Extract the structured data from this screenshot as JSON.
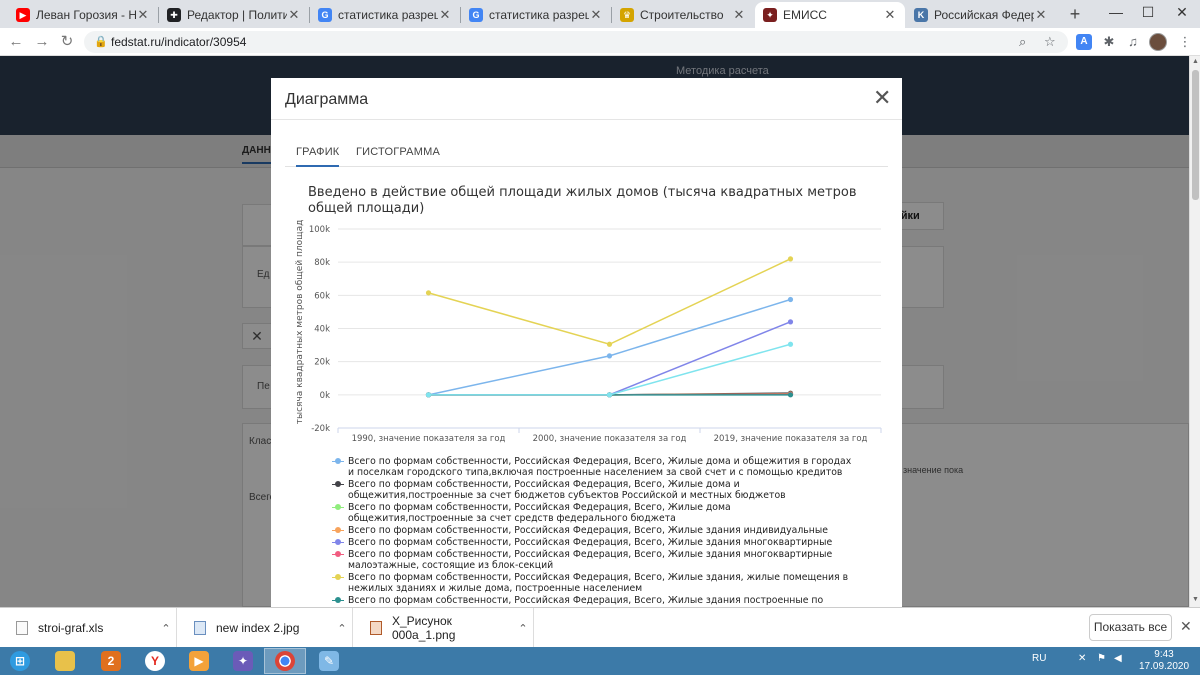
{
  "browser": {
    "tabs": [
      {
        "title": "Леван Горозия - Н",
        "icon": "youtube-icon",
        "color": "#ff0000",
        "glyph": "▶"
      },
      {
        "title": "Редактор | Политика П",
        "icon": "editor-icon",
        "color": "#202124",
        "glyph": "✚"
      },
      {
        "title": "статистика разрешени",
        "icon": "google-icon",
        "color": "#4285f4",
        "glyph": "G"
      },
      {
        "title": "статистика разрешени",
        "icon": "google-icon",
        "color": "#4285f4",
        "glyph": "G"
      },
      {
        "title": "Строительство",
        "icon": "emblem-icon",
        "color": "#d4a400",
        "glyph": "♛"
      },
      {
        "title": "ЕМИСС",
        "icon": "eagle-icon",
        "color": "#7a1f1f",
        "glyph": "✦"
      },
      {
        "title": "Российская Федерация",
        "icon": "k-icon",
        "color": "#4a76a8",
        "glyph": "K"
      }
    ],
    "url": "fedstat.ru/indicator/30954",
    "new_tab": "+",
    "win_min": "—",
    "win_max": "☐",
    "win_close": "✕"
  },
  "page_behind": {
    "method": "Методика расчета",
    "tab_data": "ДАННЫ",
    "settings_btn": "ойки",
    "ed": "Ед",
    "pe": "Пе",
    "klass": "Класс",
    "vsego": "Всего",
    "znach": "значение пока"
  },
  "modal": {
    "title": "Диаграмма",
    "close": "✕",
    "tabs": [
      "ГРАФИК",
      "ГИСТОГРАММА"
    ],
    "chart_title": "Введено в действие общей площади жилых домов (тысяча квадратных метров общей площади)"
  },
  "chart_data": {
    "type": "line",
    "title": "Введено в действие общей площади жилых домов (тысяча квадратных метров общей площади)",
    "ylabel": "тысяча квадратных метров общей площади",
    "xlabel": "",
    "categories": [
      "1990, значение показателя за год",
      "2000, значение показателя за год",
      "2019, значение показателя за год"
    ],
    "y_ticks": [
      "100k",
      "80k",
      "60k",
      "40k",
      "20k",
      "0k",
      "-20k"
    ],
    "ylim": [
      -20000,
      100000
    ],
    "grid": true,
    "legend_position": "bottom",
    "series": [
      {
        "name": "Всего по формам собственности, Российская Федерация, Всего, Жилые дома и общежития в городах и поселкам городского типа,включая построенные населением за свой счет и с помощью кредитов",
        "color": "#7cb5ec",
        "values": [
          0,
          23500,
          57500
        ]
      },
      {
        "name": "Всего по формам собственности, Российская Федерация, Всего, Жилые дома и общежития,построенные за счет бюджетов субъектов Российской и местных бюджетов",
        "color": "#434348",
        "values": [
          0,
          0,
          1000
        ]
      },
      {
        "name": "Всего по формам собственности, Российская Федерация, Всего, Жилые дома общежития,построенные за счет средств федерального бюджета",
        "color": "#90ed7d",
        "values": [
          0,
          0,
          300
        ]
      },
      {
        "name": "Всего по формам собственности, Российская Федерация, Всего, Жилые здания индивидуальные",
        "color": "#f7a35c",
        "values": [
          0,
          0,
          500
        ]
      },
      {
        "name": "Всего по формам собственности, Российская Федерация, Всего, Жилые здания многоквартирные",
        "color": "#8085e9",
        "values": [
          0,
          0,
          44000
        ]
      },
      {
        "name": "Всего по формам собственности, Российская Федерация, Всего, Жилые здания многоквартирные малоэтажные, состоящие из блок-секций",
        "color": "#f15c80",
        "values": [
          0,
          0,
          200
        ]
      },
      {
        "name": "Всего по формам собственности, Российская Федерация, Всего, Жилые здания, жилые помещения в нежилых зданиях и жилые дома, построенные населением",
        "color": "#e4d354",
        "values": [
          61500,
          30500,
          82000
        ]
      },
      {
        "name": "Всего по формам собственности, Российская Федерация, Всего, Жилые здания построенные по ипотечному",
        "color": "#2b908f",
        "values": [
          0,
          0,
          0
        ]
      },
      {
        "name": "",
        "color": "#7fe4ee",
        "values": [
          0,
          0,
          30500
        ]
      }
    ]
  },
  "downloads": [
    {
      "name": "stroi-graf.xls"
    },
    {
      "name": "new index 2.jpg"
    },
    {
      "name": "X_Рисунок 000а_1.png"
    }
  ],
  "downloads_show_all": "Показать все",
  "taskbar": {
    "lang": "RU",
    "time": "9:43",
    "date": "17.09.2020"
  }
}
